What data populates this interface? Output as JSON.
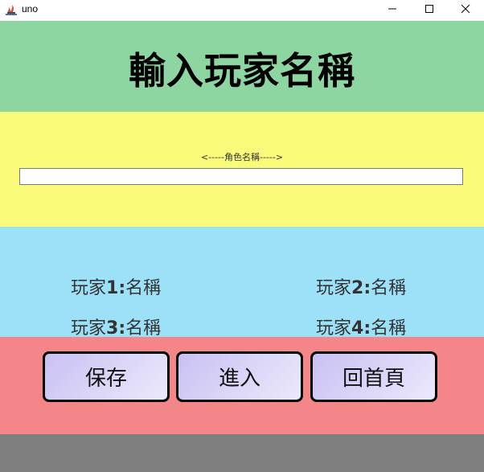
{
  "window": {
    "title": "uno",
    "icon": "java-app-icon",
    "controls": [
      "minimize-icon",
      "maximize-icon",
      "close-icon"
    ]
  },
  "header": {
    "title": "輸入玩家名稱",
    "background": "#8dd6a1"
  },
  "name_entry": {
    "label": "<-----角色名稱----->",
    "value": "",
    "background": "#f9f97a"
  },
  "players": {
    "background": "#9de1f8",
    "items": [
      {
        "prefix": "玩家",
        "number": "1:",
        "name": "名稱"
      },
      {
        "prefix": "玩家",
        "number": "2:",
        "name": "名稱"
      },
      {
        "prefix": "玩家",
        "number": "3:",
        "name": "名稱"
      },
      {
        "prefix": "玩家",
        "number": "4:",
        "name": "名稱"
      }
    ]
  },
  "actions": {
    "background": "#f4868a",
    "save_label": "保存",
    "enter_label": "進入",
    "home_label": "回首頁"
  },
  "footer": {
    "background": "#7f7f7f"
  }
}
